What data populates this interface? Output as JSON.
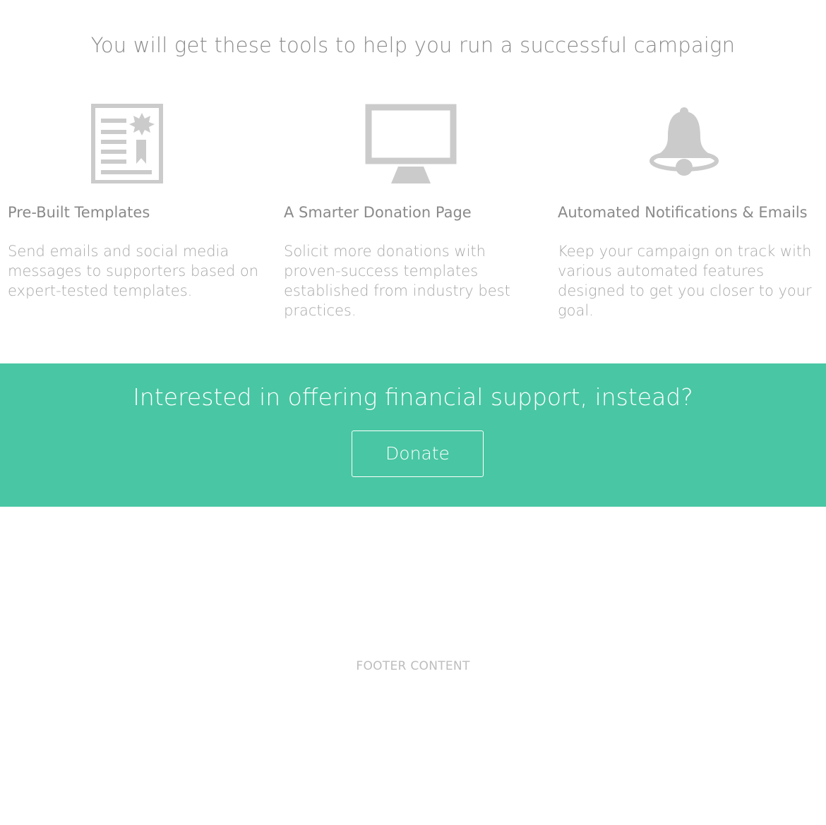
{
  "tools_section": {
    "heading": "You will get these tools to help you run a successful campaign",
    "features": [
      {
        "icon": "certificate-document-icon",
        "title": "Pre-Built Templates",
        "description": "Send emails and social media messages to supporters based on expert-tested templates."
      },
      {
        "icon": "monitor-icon",
        "title": "A Smarter Donation Page",
        "description": "Solicit more donations with proven-success templates established from industry best practices."
      },
      {
        "icon": "bell-icon",
        "title": "Automated Notifications & Emails",
        "description": "Keep your campaign on track with various automated features designed to get you closer to your goal."
      }
    ]
  },
  "cta": {
    "heading": "Interested in offering financial support, instead?",
    "button_label": "Donate"
  },
  "footer": {
    "text": "FOOTER CONTENT"
  },
  "colors": {
    "accent": "#49c6a3",
    "icon_gray": "#cbcbcb",
    "heading_gray": "#8a8a8a",
    "body_gray": "#a8a8a8"
  }
}
